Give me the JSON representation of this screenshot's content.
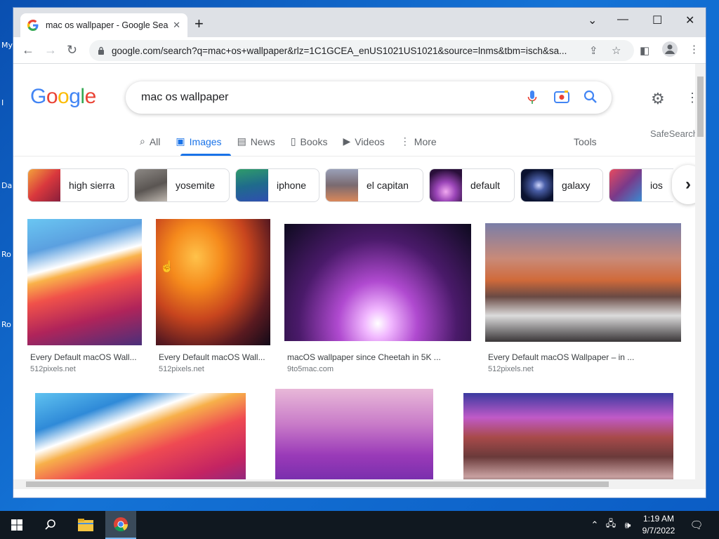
{
  "desktop": {
    "labels": [
      "My",
      "I",
      "Da",
      "Ro",
      "Ro"
    ]
  },
  "browser": {
    "tab_title": "mac os wallpaper - Google Search",
    "tab_close": "✕",
    "new_tab": "+",
    "url": "google.com/search?q=mac+os+wallpaper&rlz=1C1GCEA_enUS1021US1021&source=lnms&tbm=isch&sa...",
    "window_controls": {
      "dropdown": "⌄",
      "minimize": "—",
      "maximize": "☐",
      "close": "✕"
    }
  },
  "google": {
    "logo_letters": [
      {
        "ch": "G",
        "color": "#4285f4"
      },
      {
        "ch": "o",
        "color": "#ea4335"
      },
      {
        "ch": "o",
        "color": "#fbbc05"
      },
      {
        "ch": "g",
        "color": "#4285f4"
      },
      {
        "ch": "l",
        "color": "#34a853"
      },
      {
        "ch": "e",
        "color": "#ea4335"
      }
    ],
    "query": "mac os wallpaper",
    "safesearch": "SafeSearch",
    "tools": "Tools",
    "tabs": [
      {
        "label": "All",
        "icon": "search-icon"
      },
      {
        "label": "Images",
        "icon": "image-icon",
        "active": true
      },
      {
        "label": "News",
        "icon": "news-icon"
      },
      {
        "label": "Books",
        "icon": "book-icon"
      },
      {
        "label": "Videos",
        "icon": "video-icon"
      },
      {
        "label": "More",
        "icon": "more-vert-icon"
      }
    ],
    "chips": [
      {
        "label": "high sierra",
        "color": "#d94a3a",
        "color2": "#f08a3a"
      },
      {
        "label": "yosemite",
        "color": "#6f6a66",
        "color2": "#b9b4ae"
      },
      {
        "label": "iphone",
        "color": "#2b8a63",
        "color2": "#2f63b5"
      },
      {
        "label": "el capitan",
        "color": "#7d6a72",
        "color2": "#c8845a"
      },
      {
        "label": "default",
        "color": "#30123f",
        "color2": "#c85ec8"
      },
      {
        "label": "galaxy",
        "color": "#0b1433",
        "color2": "#5a6fb5"
      },
      {
        "label": "ios",
        "color": "#c13b4a",
        "color2": "#3b8ac1"
      }
    ],
    "results": [
      {
        "title": "Every Default macOS Wall...",
        "source": "512pixels.net"
      },
      {
        "title": "Every Default macOS Wall...",
        "source": "512pixels.net"
      },
      {
        "title": "macOS wallpaper since Cheetah in 5K ...",
        "source": "9to5mac.com"
      },
      {
        "title": "Every Default macOS Wallpaper – in ...",
        "source": "512pixels.net"
      },
      {
        "title": "",
        "source": ""
      },
      {
        "title": "",
        "source": ""
      },
      {
        "title": "",
        "source": ""
      }
    ]
  },
  "taskbar": {
    "time": "1:19 AM",
    "date": "9/7/2022"
  }
}
